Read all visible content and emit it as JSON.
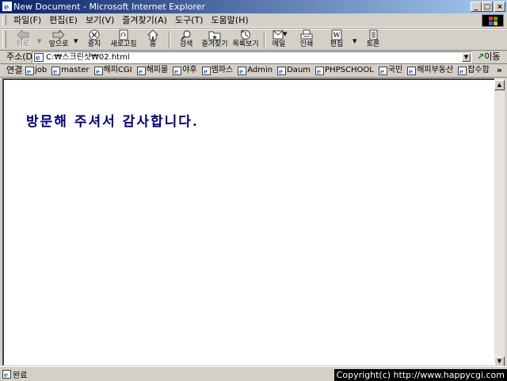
{
  "window": {
    "title": "New Document - Microsoft Internet Explorer",
    "controls": {
      "minimize": "_",
      "maximize": "□",
      "close": "×"
    }
  },
  "menubar": {
    "items": [
      "파일(F)",
      "편집(E)",
      "보기(V)",
      "즐겨찾기(A)",
      "도구(T)",
      "도움말(H)"
    ]
  },
  "toolbar": {
    "back": "뒤로",
    "forward": "앞으로",
    "stop": "중지",
    "refresh": "새로고침",
    "home": "홈",
    "search": "검색",
    "favorites": "즐겨찾기",
    "history": "목록보기",
    "mail": "메일",
    "print": "인쇄",
    "edit": "편집",
    "discuss": "토론"
  },
  "addressbar": {
    "label": "주소(D)",
    "value": "C:₩스크린샷₩02.html",
    "go_label": "이동"
  },
  "linksbar": {
    "label": "연결",
    "items": [
      "job",
      "master",
      "해피CGI",
      "해피몰",
      "야후",
      "엠파스",
      "Admin",
      "Daum",
      "PHPSCHOOL",
      "국민",
      "해피부동산",
      "잡수합"
    ],
    "more": "»"
  },
  "page": {
    "greeting": "방문해 주셔서 감사합니다."
  },
  "statusbar": {
    "text": "완료",
    "copyright": "Copyright(c) http://www.happycgi.com"
  }
}
